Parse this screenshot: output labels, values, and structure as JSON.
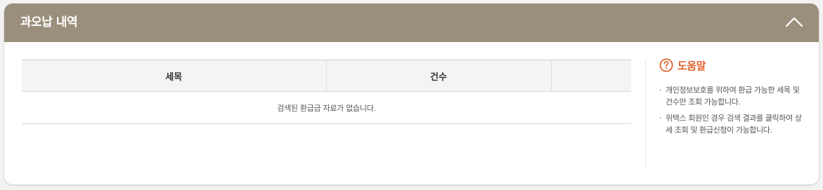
{
  "panel": {
    "title": "과오납 내역",
    "collapse_icon": "chevron-up-icon"
  },
  "table": {
    "headers": [
      "세목",
      "건수",
      ""
    ],
    "empty_message": "검색된 환급금 자료가 없습니다."
  },
  "help": {
    "icon": "question-circle-icon",
    "title": "도움말",
    "bullet": "·",
    "items": [
      "개인정보보호를 위하여 환급 가능한 세목 및 건수만 조회 가능합니다.",
      "위택스 회원인 경우 검색 결과를 클릭하여 상세 조회 및 환급신청이 가능합니다."
    ]
  },
  "colors": {
    "header_bg": "#9a8f7c",
    "accent": "#e0622e"
  }
}
